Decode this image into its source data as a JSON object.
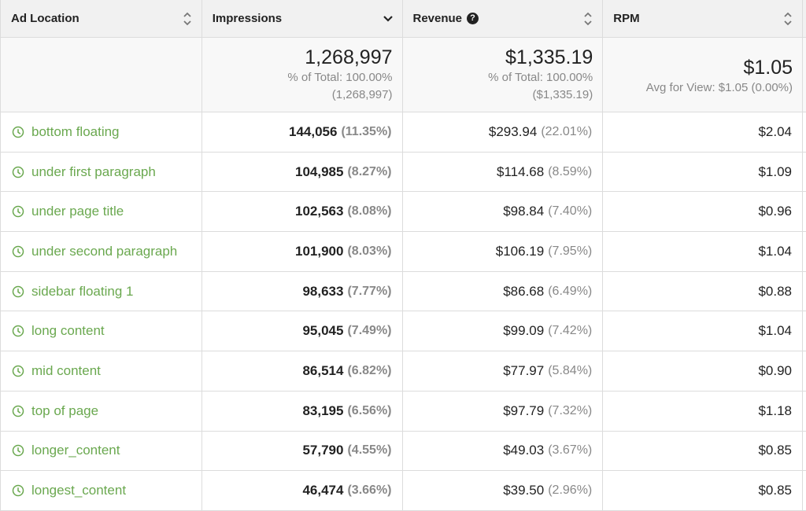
{
  "colors": {
    "link_green": "#6aa84f",
    "header_bg": "#f1f1f1",
    "totals_bg": "#f8f8f8",
    "border": "#dcdcdc",
    "muted_text": "#888888"
  },
  "headers": [
    {
      "label": "Ad Location",
      "sort_icon": "sort-both-icon"
    },
    {
      "label": "Impressions",
      "sort_icon": "sort-desc-icon"
    },
    {
      "label": "Revenue",
      "help_icon": "help-circle-icon",
      "help_glyph": "?",
      "sort_icon": "sort-both-icon"
    },
    {
      "label": "RPM",
      "sort_icon": "sort-both-icon"
    }
  ],
  "totals": {
    "impressions": {
      "value": "1,268,997",
      "sub1": "% of Total: 100.00%",
      "sub2": "(1,268,997)"
    },
    "revenue": {
      "value": "$1,335.19",
      "sub1": "% of Total: 100.00%",
      "sub2": "($1,335.19)"
    },
    "rpm": {
      "value": "$1.05",
      "sub1": "Avg for View: $1.05 (0.00%)"
    }
  },
  "rows": [
    {
      "location": "bottom floating",
      "impressions": "144,056",
      "impressions_pct": "(11.35%)",
      "revenue": "$293.94",
      "revenue_pct": "(22.01%)",
      "rpm": "$2.04"
    },
    {
      "location": "under first paragraph",
      "impressions": "104,985",
      "impressions_pct": "(8.27%)",
      "revenue": "$114.68",
      "revenue_pct": "(8.59%)",
      "rpm": "$1.09"
    },
    {
      "location": "under page title",
      "impressions": "102,563",
      "impressions_pct": "(8.08%)",
      "revenue": "$98.84",
      "revenue_pct": "(7.40%)",
      "rpm": "$0.96"
    },
    {
      "location": "under second paragraph",
      "impressions": "101,900",
      "impressions_pct": "(8.03%)",
      "revenue": "$106.19",
      "revenue_pct": "(7.95%)",
      "rpm": "$1.04"
    },
    {
      "location": "sidebar floating 1",
      "impressions": "98,633",
      "impressions_pct": "(7.77%)",
      "revenue": "$86.68",
      "revenue_pct": "(6.49%)",
      "rpm": "$0.88"
    },
    {
      "location": "long content",
      "impressions": "95,045",
      "impressions_pct": "(7.49%)",
      "revenue": "$99.09",
      "revenue_pct": "(7.42%)",
      "rpm": "$1.04"
    },
    {
      "location": "mid content",
      "impressions": "86,514",
      "impressions_pct": "(6.82%)",
      "revenue": "$77.97",
      "revenue_pct": "(5.84%)",
      "rpm": "$0.90"
    },
    {
      "location": "top of page",
      "impressions": "83,195",
      "impressions_pct": "(6.56%)",
      "revenue": "$97.79",
      "revenue_pct": "(7.32%)",
      "rpm": "$1.18"
    },
    {
      "location": "longer_content",
      "impressions": "57,790",
      "impressions_pct": "(4.55%)",
      "revenue": "$49.03",
      "revenue_pct": "(3.67%)",
      "rpm": "$0.85"
    },
    {
      "location": "longest_content",
      "impressions": "46,474",
      "impressions_pct": "(3.66%)",
      "revenue": "$39.50",
      "revenue_pct": "(2.96%)",
      "rpm": "$0.85"
    }
  ]
}
